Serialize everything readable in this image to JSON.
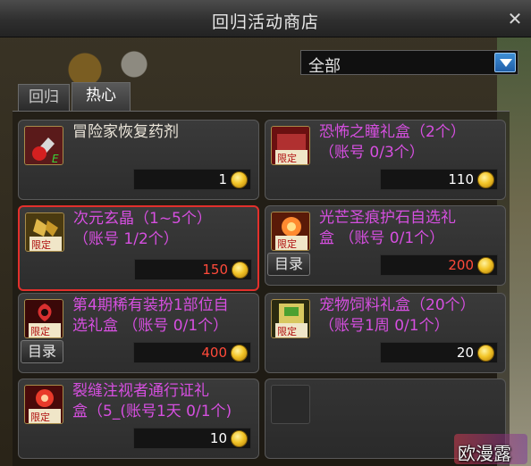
{
  "window": {
    "title": "回归活动商店"
  },
  "filter": {
    "selected": "全部"
  },
  "tabs": [
    {
      "label": "回归",
      "active": false
    },
    {
      "label": "热心",
      "active": true
    }
  ],
  "items": [
    {
      "name": "冒险家恢复药剂",
      "price": "1",
      "icon": "potion-icon"
    },
    {
      "name": "恐怖之瞳礼盒（2个）\n（账号 0/3个）",
      "price": "110",
      "icon": "limited-box-icon",
      "badge": "限定"
    },
    {
      "name": "次元玄晶（1~5个）\n（账号 1/2个）",
      "price": "150",
      "icon": "limited-crystal-icon",
      "badge": "限定"
    },
    {
      "name": "光芒圣痕护石自选礼\n盒 （账号 0/1个）",
      "price": "200",
      "icon": "limited-stone-icon",
      "badge": "限定",
      "catalog": "目录"
    },
    {
      "name": "第4期稀有装扮1部位自\n选礼盒 （账号 0/1个）",
      "price": "400",
      "icon": "limited-costume-icon",
      "badge": "限定",
      "catalog": "目录"
    },
    {
      "name": "宠物饲料礼盒（20个）\n（账号1周 0/1个）",
      "price": "20",
      "icon": "limited-petfood-icon",
      "badge": "限定"
    },
    {
      "name": "裂缝注视者通行证礼\n盒（5_(账号1天 0/1个)",
      "price": "10",
      "icon": "limited-pass-icon",
      "badge": "限定"
    }
  ],
  "watermark": "欧漫露",
  "colors": {
    "item_name": "#d64fe0",
    "selected_border": "#e2302c",
    "price_red": "#ff4a3a",
    "coin": "#f3c528",
    "dropdown_blue": "#2f7ac4"
  }
}
